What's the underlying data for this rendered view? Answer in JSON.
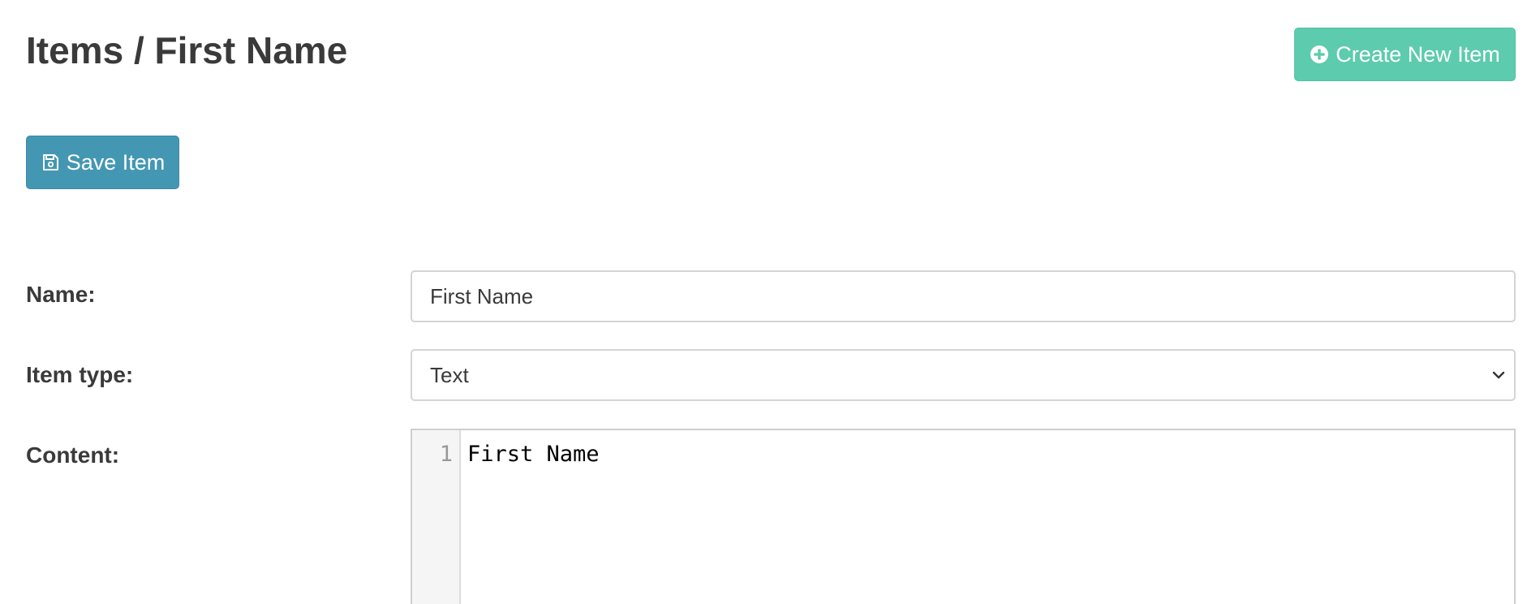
{
  "header": {
    "title": "Items / First Name",
    "create_button_label": "Create New Item",
    "create_button_icon": "plus-circle-icon"
  },
  "toolbar": {
    "save_button_label": "Save Item",
    "save_button_icon": "floppy-disk-icon"
  },
  "form": {
    "name_label": "Name:",
    "name_value": "First Name",
    "type_label": "Item type:",
    "type_value": "Text",
    "content_label": "Content:",
    "editor": {
      "line_number": "1",
      "line_text": "First Name"
    }
  },
  "colors": {
    "create_button": "#5dcbae",
    "save_button": "#4397b3",
    "text": "#3a3a3a"
  }
}
